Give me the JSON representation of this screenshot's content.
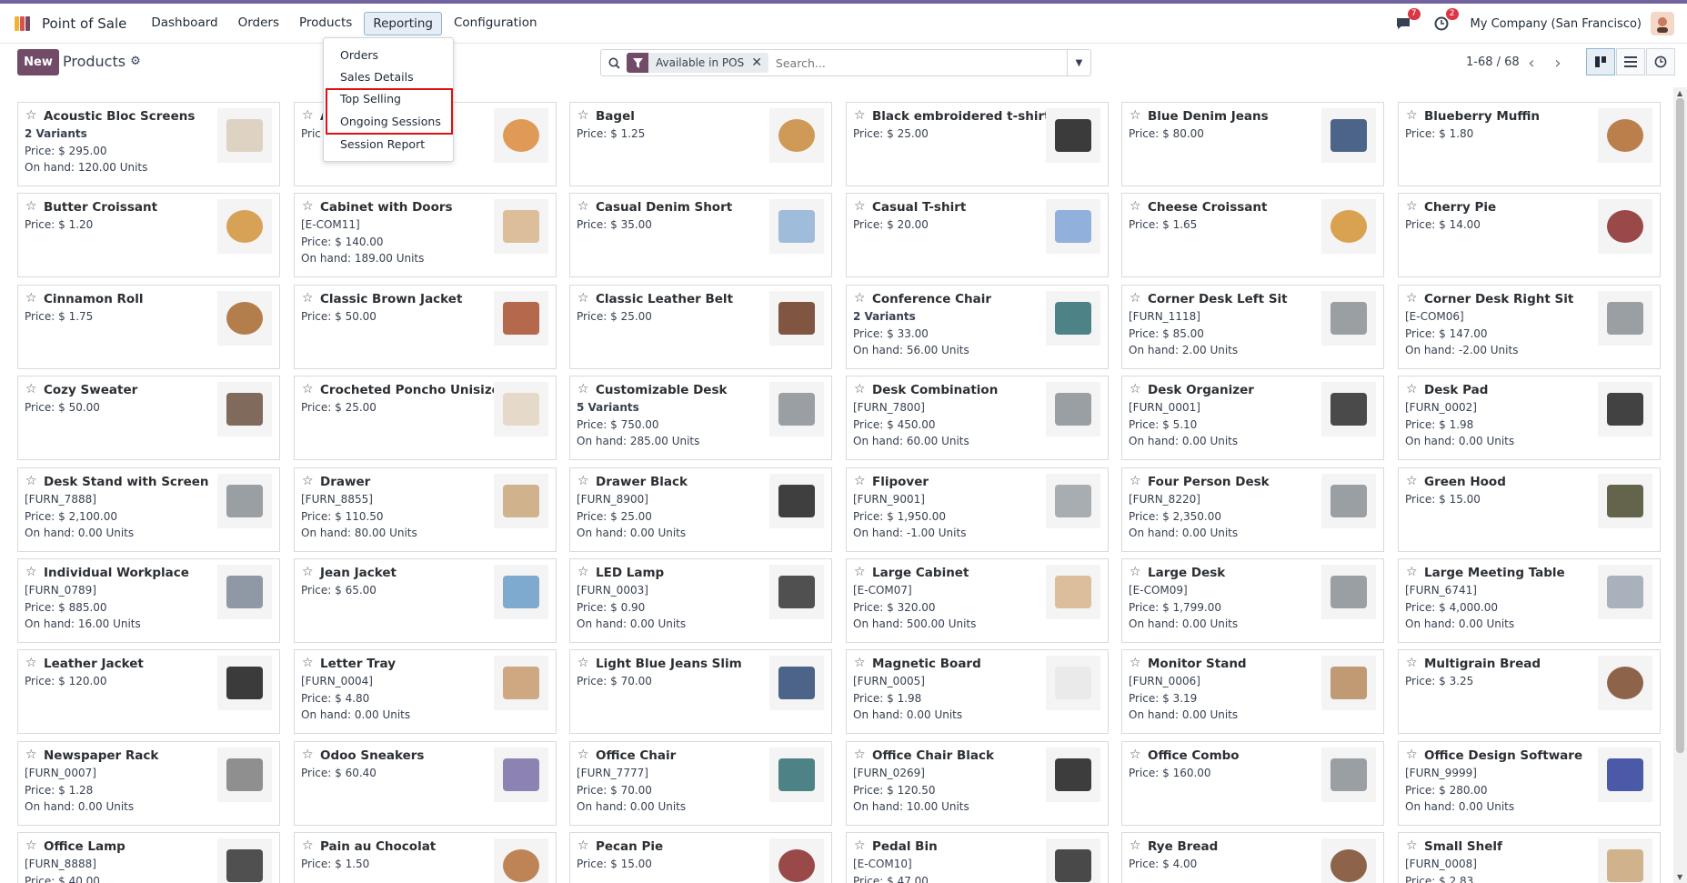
{
  "app": {
    "title": "Point of Sale"
  },
  "menu": {
    "items": [
      "Dashboard",
      "Orders",
      "Products",
      "Reporting",
      "Configuration"
    ],
    "active": "Reporting"
  },
  "navbar": {
    "messages_badge": "7",
    "activity_badge": "2",
    "company": "My Company (San Francisco)"
  },
  "control_panel": {
    "new_label": "New",
    "title": "Products",
    "filter_facet": "Available in POS",
    "search_placeholder": "Search...",
    "pager": "1-68 / 68"
  },
  "reporting_menu": {
    "items": [
      "Orders",
      "Sales Details",
      "Top Selling",
      "Ongoing Sessions",
      "Session Report"
    ],
    "highlighted": [
      "Top Selling",
      "Ongoing Sessions"
    ]
  },
  "products": [
    {
      "name": "Acoustic Bloc Screens",
      "lines": [
        {
          "t": "2 Variants",
          "b": true
        },
        {
          "t": "Price: $ 295.00"
        },
        {
          "t": "On hand: 120.00 Units"
        }
      ],
      "icon": "panel-screens-icon"
    },
    {
      "name": "A",
      "lines": [
        {
          "t": "Pric"
        }
      ],
      "icon": "pizza-icon"
    },
    {
      "name": "Bagel",
      "lines": [
        {
          "t": "Price: $ 1.25"
        }
      ],
      "icon": "bagel-icon"
    },
    {
      "name": "Black embroidered t-shirt",
      "lines": [
        {
          "t": "Price: $ 25.00"
        }
      ],
      "icon": "tshirt-black-icon"
    },
    {
      "name": "Blue Denim Jeans",
      "lines": [
        {
          "t": "Price: $ 80.00"
        }
      ],
      "icon": "jeans-icon"
    },
    {
      "name": "Blueberry Muffin",
      "lines": [
        {
          "t": "Price: $ 1.80"
        }
      ],
      "icon": "muffin-icon"
    },
    {
      "name": "Butter Croissant",
      "lines": [
        {
          "t": "Price: $ 1.20"
        }
      ],
      "icon": "croissant-bag-icon"
    },
    {
      "name": "Cabinet with Doors",
      "lines": [
        {
          "t": "[E-COM11]"
        },
        {
          "t": "Price: $ 140.00"
        },
        {
          "t": "On hand: 189.00 Units"
        }
      ],
      "icon": "cabinet-icon"
    },
    {
      "name": "Casual Denim Short",
      "lines": [
        {
          "t": "Price: $ 35.00"
        }
      ],
      "icon": "shorts-icon"
    },
    {
      "name": "Casual T-shirt",
      "lines": [
        {
          "t": "Price: $ 20.00"
        }
      ],
      "icon": "tshirt-blue-icon"
    },
    {
      "name": "Cheese Croissant",
      "lines": [
        {
          "t": "Price: $ 1.65"
        }
      ],
      "icon": "croissant-icon"
    },
    {
      "name": "Cherry Pie",
      "lines": [
        {
          "t": "Price: $ 14.00"
        }
      ],
      "icon": "pie-icon"
    },
    {
      "name": "Cinnamon Roll",
      "lines": [
        {
          "t": "Price: $ 1.75"
        }
      ],
      "icon": "cinnamon-roll-icon"
    },
    {
      "name": "Classic Brown Jacket",
      "lines": [
        {
          "t": "Price: $ 50.00"
        }
      ],
      "icon": "jacket-icon"
    },
    {
      "name": "Classic Leather Belt",
      "lines": [
        {
          "t": "Price: $ 25.00"
        }
      ],
      "icon": "belt-icon"
    },
    {
      "name": "Conference Chair",
      "lines": [
        {
          "t": "2 Variants",
          "b": true
        },
        {
          "t": "Price: $ 33.00"
        },
        {
          "t": "On hand: 56.00 Units"
        }
      ],
      "icon": "chair-icon"
    },
    {
      "name": "Corner Desk Left Sit",
      "lines": [
        {
          "t": "[FURN_1118]"
        },
        {
          "t": "Price: $ 85.00"
        },
        {
          "t": "On hand: 2.00 Units"
        }
      ],
      "icon": "desk-icon"
    },
    {
      "name": "Corner Desk Right Sit",
      "lines": [
        {
          "t": "[E-COM06]"
        },
        {
          "t": "Price: $ 147.00"
        },
        {
          "t": "On hand: -2.00 Units"
        }
      ],
      "icon": "desk-icon"
    },
    {
      "name": "Cozy Sweater",
      "lines": [
        {
          "t": "Price: $ 50.00"
        }
      ],
      "icon": "sweater-icon"
    },
    {
      "name": "Crocheted Poncho Unisize",
      "lines": [
        {
          "t": "Price: $ 25.00"
        }
      ],
      "icon": "poncho-icon"
    },
    {
      "name": "Customizable Desk",
      "lines": [
        {
          "t": "5 Variants",
          "b": true
        },
        {
          "t": "Price: $ 750.00"
        },
        {
          "t": "On hand: 285.00 Units"
        }
      ],
      "icon": "desk-icon"
    },
    {
      "name": "Desk Combination",
      "lines": [
        {
          "t": "[FURN_7800]"
        },
        {
          "t": "Price: $ 450.00"
        },
        {
          "t": "On hand: 60.00 Units"
        }
      ],
      "icon": "desk-icon"
    },
    {
      "name": "Desk Organizer",
      "lines": [
        {
          "t": "[FURN_0001]"
        },
        {
          "t": "Price: $ 5.10"
        },
        {
          "t": "On hand: 0.00 Units"
        }
      ],
      "icon": "organizer-icon"
    },
    {
      "name": "Desk Pad",
      "lines": [
        {
          "t": "[FURN_0002]"
        },
        {
          "t": "Price: $ 1.98"
        },
        {
          "t": "On hand: 0.00 Units"
        }
      ],
      "icon": "desk-pad-icon"
    },
    {
      "name": "Desk Stand with Screen",
      "lines": [
        {
          "t": "[FURN_7888]"
        },
        {
          "t": "Price: $ 2,100.00"
        },
        {
          "t": "On hand: 0.00 Units"
        }
      ],
      "icon": "desk-icon"
    },
    {
      "name": "Drawer",
      "lines": [
        {
          "t": "[FURN_8855]"
        },
        {
          "t": "Price: $ 110.50"
        },
        {
          "t": "On hand: 80.00 Units"
        }
      ],
      "icon": "drawer-icon"
    },
    {
      "name": "Drawer Black",
      "lines": [
        {
          "t": "[FURN_8900]"
        },
        {
          "t": "Price: $ 25.00"
        },
        {
          "t": "On hand: 0.00 Units"
        }
      ],
      "icon": "drawer-black-icon"
    },
    {
      "name": "Flipover",
      "lines": [
        {
          "t": "[FURN_9001]"
        },
        {
          "t": "Price: $ 1,950.00"
        },
        {
          "t": "On hand: -1.00 Units"
        }
      ],
      "icon": "flipover-icon"
    },
    {
      "name": "Four Person Desk",
      "lines": [
        {
          "t": "[FURN_8220]"
        },
        {
          "t": "Price: $ 2,350.00"
        },
        {
          "t": "On hand: 0.00 Units"
        }
      ],
      "icon": "desk-icon"
    },
    {
      "name": "Green Hood",
      "lines": [
        {
          "t": "Price: $ 15.00"
        }
      ],
      "icon": "hood-icon"
    },
    {
      "name": "Individual Workplace",
      "lines": [
        {
          "t": "[FURN_0789]"
        },
        {
          "t": "Price: $ 885.00"
        },
        {
          "t": "On hand: 16.00 Units"
        }
      ],
      "icon": "workplace-icon"
    },
    {
      "name": "Jean Jacket",
      "lines": [
        {
          "t": "Price: $ 65.00"
        }
      ],
      "icon": "jean-jacket-icon"
    },
    {
      "name": "LED Lamp",
      "lines": [
        {
          "t": "[FURN_0003]"
        },
        {
          "t": "Price: $ 0.90"
        },
        {
          "t": "On hand: 0.00 Units"
        }
      ],
      "icon": "lamp-icon"
    },
    {
      "name": "Large Cabinet",
      "lines": [
        {
          "t": "[E-COM07]"
        },
        {
          "t": "Price: $ 320.00"
        },
        {
          "t": "On hand: 500.00 Units"
        }
      ],
      "icon": "cabinet-icon"
    },
    {
      "name": "Large Desk",
      "lines": [
        {
          "t": "[E-COM09]"
        },
        {
          "t": "Price: $ 1,799.00"
        },
        {
          "t": "On hand: 0.00 Units"
        }
      ],
      "icon": "desk-icon"
    },
    {
      "name": "Large Meeting Table",
      "lines": [
        {
          "t": "[FURN_6741]"
        },
        {
          "t": "Price: $ 4,000.00"
        },
        {
          "t": "On hand: 0.00 Units"
        }
      ],
      "icon": "table-icon"
    },
    {
      "name": "Leather Jacket",
      "lines": [
        {
          "t": "Price: $ 120.00"
        }
      ],
      "icon": "leather-jacket-icon"
    },
    {
      "name": "Letter Tray",
      "lines": [
        {
          "t": "[FURN_0004]"
        },
        {
          "t": "Price: $ 4.80"
        },
        {
          "t": "On hand: 0.00 Units"
        }
      ],
      "icon": "letter-tray-icon"
    },
    {
      "name": "Light Blue Jeans Slim",
      "lines": [
        {
          "t": "Price: $ 70.00"
        }
      ],
      "icon": "jeans-icon"
    },
    {
      "name": "Magnetic Board",
      "lines": [
        {
          "t": "[FURN_0005]"
        },
        {
          "t": "Price: $ 1.98"
        },
        {
          "t": "On hand: 0.00 Units"
        }
      ],
      "icon": "board-icon"
    },
    {
      "name": "Monitor Stand",
      "lines": [
        {
          "t": "[FURN_0006]"
        },
        {
          "t": "Price: $ 3.19"
        },
        {
          "t": "On hand: 0.00 Units"
        }
      ],
      "icon": "monitor-stand-icon"
    },
    {
      "name": "Multigrain Bread",
      "lines": [
        {
          "t": "Price: $ 3.25"
        }
      ],
      "icon": "bread-icon"
    },
    {
      "name": "Newspaper Rack",
      "lines": [
        {
          "t": "[FURN_0007]"
        },
        {
          "t": "Price: $ 1.28"
        },
        {
          "t": "On hand: 0.00 Units"
        }
      ],
      "icon": "rack-icon"
    },
    {
      "name": "Odoo Sneakers",
      "lines": [
        {
          "t": "Price: $ 60.40"
        }
      ],
      "icon": "sneakers-icon"
    },
    {
      "name": "Office Chair",
      "lines": [
        {
          "t": "[FURN_7777]"
        },
        {
          "t": "Price: $ 70.00"
        },
        {
          "t": "On hand: 0.00 Units"
        }
      ],
      "icon": "chair-icon"
    },
    {
      "name": "Office Chair Black",
      "lines": [
        {
          "t": "[FURN_0269]"
        },
        {
          "t": "Price: $ 120.50"
        },
        {
          "t": "On hand: 10.00 Units"
        }
      ],
      "icon": "chair-black-icon"
    },
    {
      "name": "Office Combo",
      "lines": [
        {
          "t": "Price: $ 160.00"
        }
      ],
      "icon": "desk-icon"
    },
    {
      "name": "Office Design Software",
      "lines": [
        {
          "t": "[FURN_9999]"
        },
        {
          "t": "Price: $ 280.00"
        },
        {
          "t": "On hand: 0.00 Units"
        }
      ],
      "icon": "software-box-icon"
    },
    {
      "name": "Office Lamp",
      "lines": [
        {
          "t": "[FURN_8888]"
        },
        {
          "t": "Price: $ 40.00"
        }
      ],
      "icon": "lamp-icon"
    },
    {
      "name": "Pain au Chocolat",
      "lines": [
        {
          "t": "Price: $ 1.50"
        }
      ],
      "icon": "pastry-icon"
    },
    {
      "name": "Pecan Pie",
      "lines": [
        {
          "t": "Price: $ 15.00"
        }
      ],
      "icon": "pie-icon"
    },
    {
      "name": "Pedal Bin",
      "lines": [
        {
          "t": "[E-COM10]"
        },
        {
          "t": "Price: $ 47.00"
        }
      ],
      "icon": "bin-icon"
    },
    {
      "name": "Rye Bread",
      "lines": [
        {
          "t": "Price: $ 4.00"
        }
      ],
      "icon": "bread-icon"
    },
    {
      "name": "Small Shelf",
      "lines": [
        {
          "t": "[FURN_0008]"
        },
        {
          "t": "Price: $ 2.83"
        }
      ],
      "icon": "shelf-icon"
    }
  ],
  "colors": {
    "brand": "#714b67",
    "facet_icon": "#714b67",
    "active_menu_bg": "#e6edf5",
    "highlight_border": "#e01010",
    "badge": "#dc3545"
  }
}
